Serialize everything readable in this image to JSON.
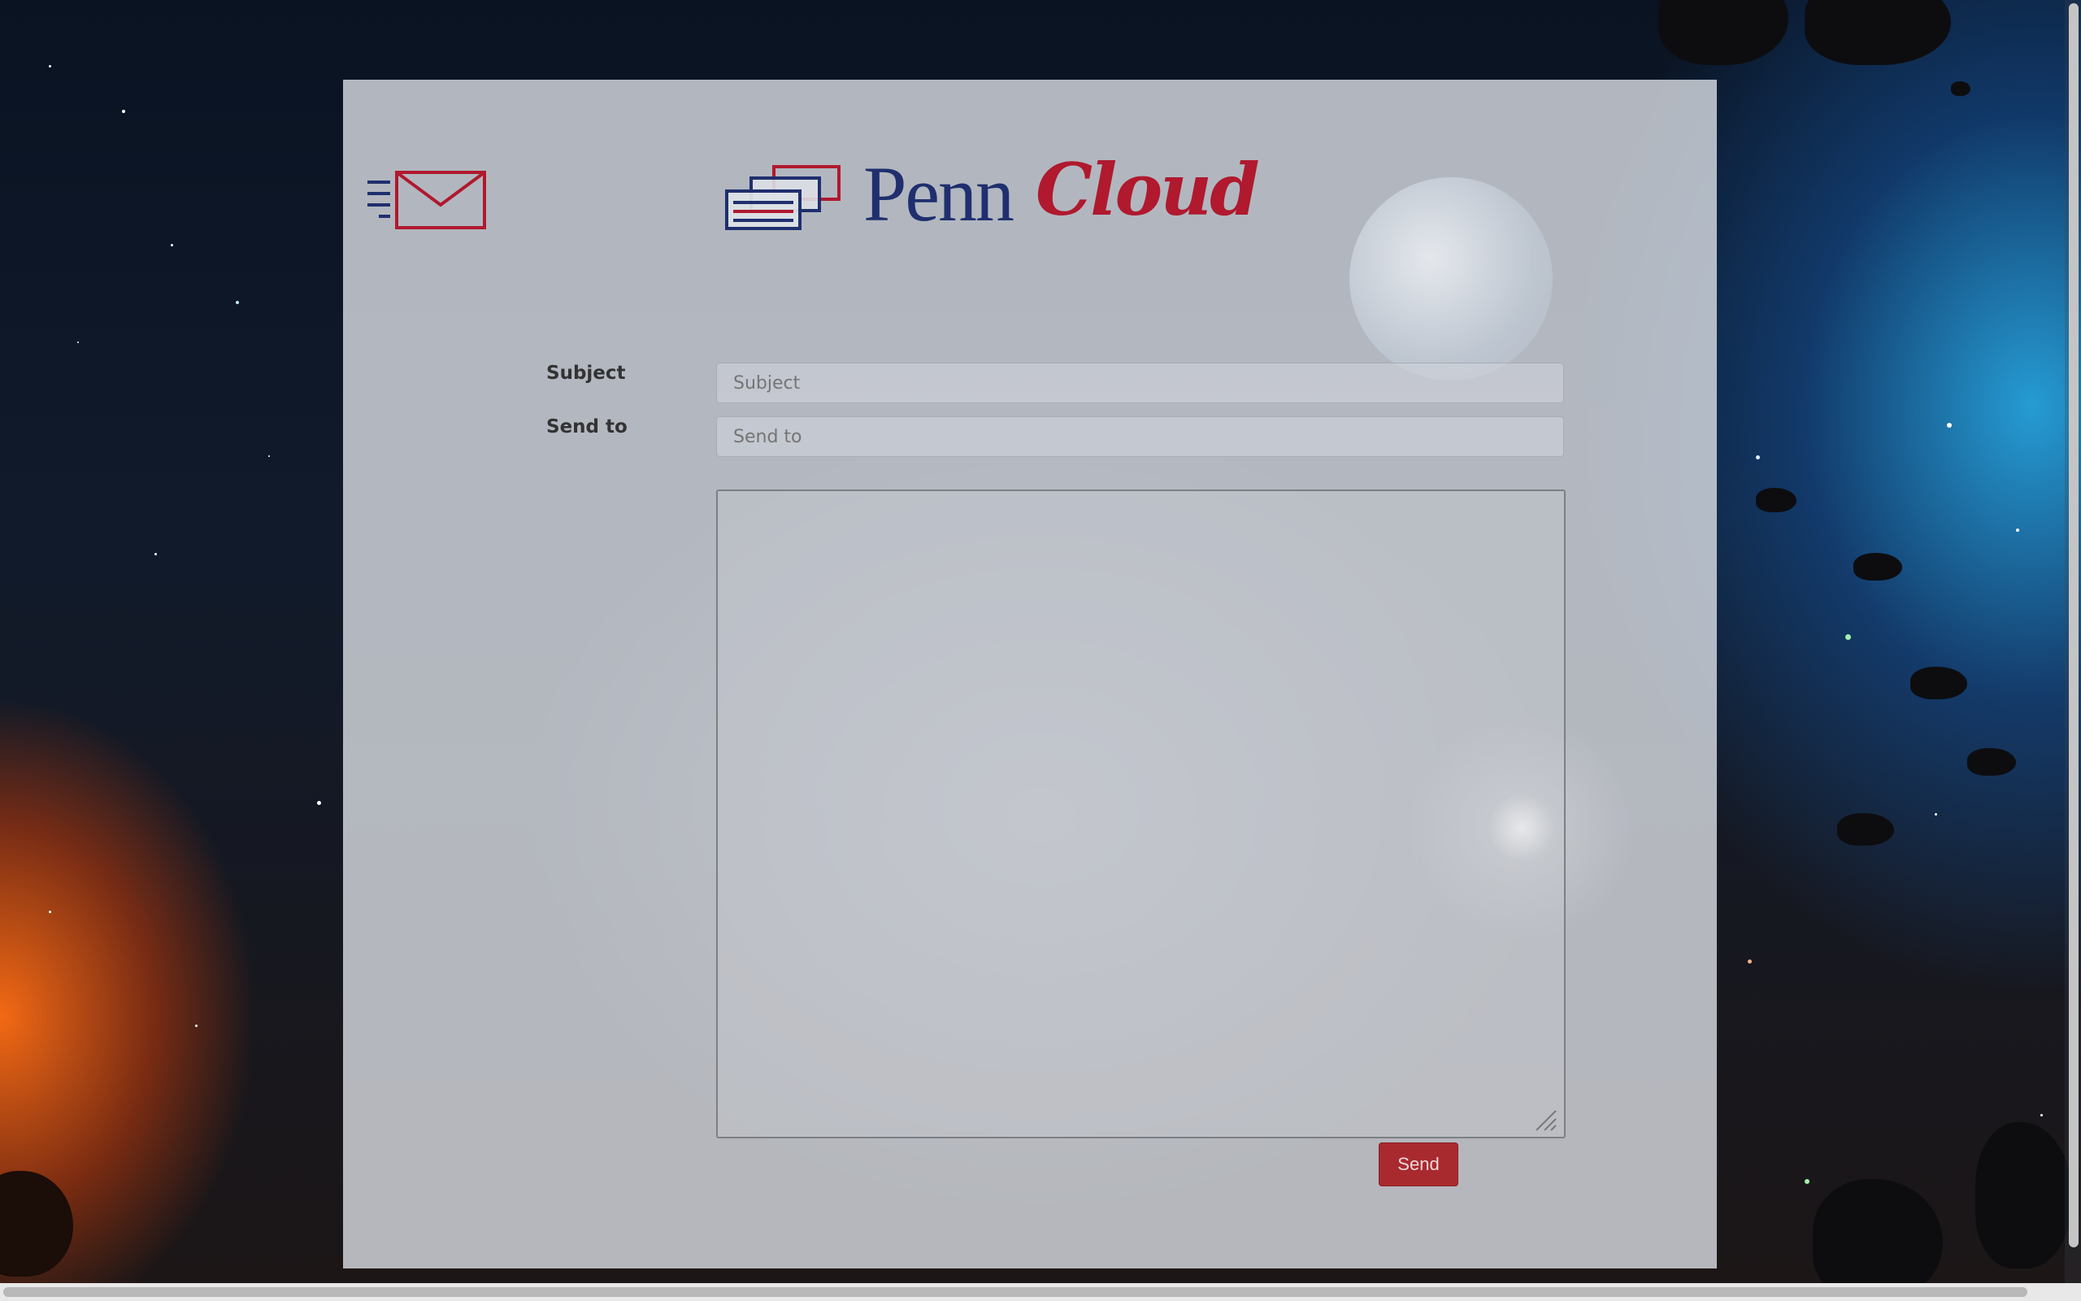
{
  "brand": {
    "name_part1": "Penn",
    "name_part2": "Cloud",
    "primary_color": "#1f2f6e",
    "accent_color": "#b0192e",
    "icons": [
      "mail-send-icon",
      "message-stack-icon"
    ]
  },
  "form": {
    "subject": {
      "label": "Subject",
      "placeholder": "Subject",
      "value": ""
    },
    "send_to": {
      "label": "Send to",
      "placeholder": "Send to",
      "value": ""
    },
    "body": {
      "value": ""
    },
    "send_button": {
      "label": "Send",
      "color": "#a82a2f"
    }
  }
}
